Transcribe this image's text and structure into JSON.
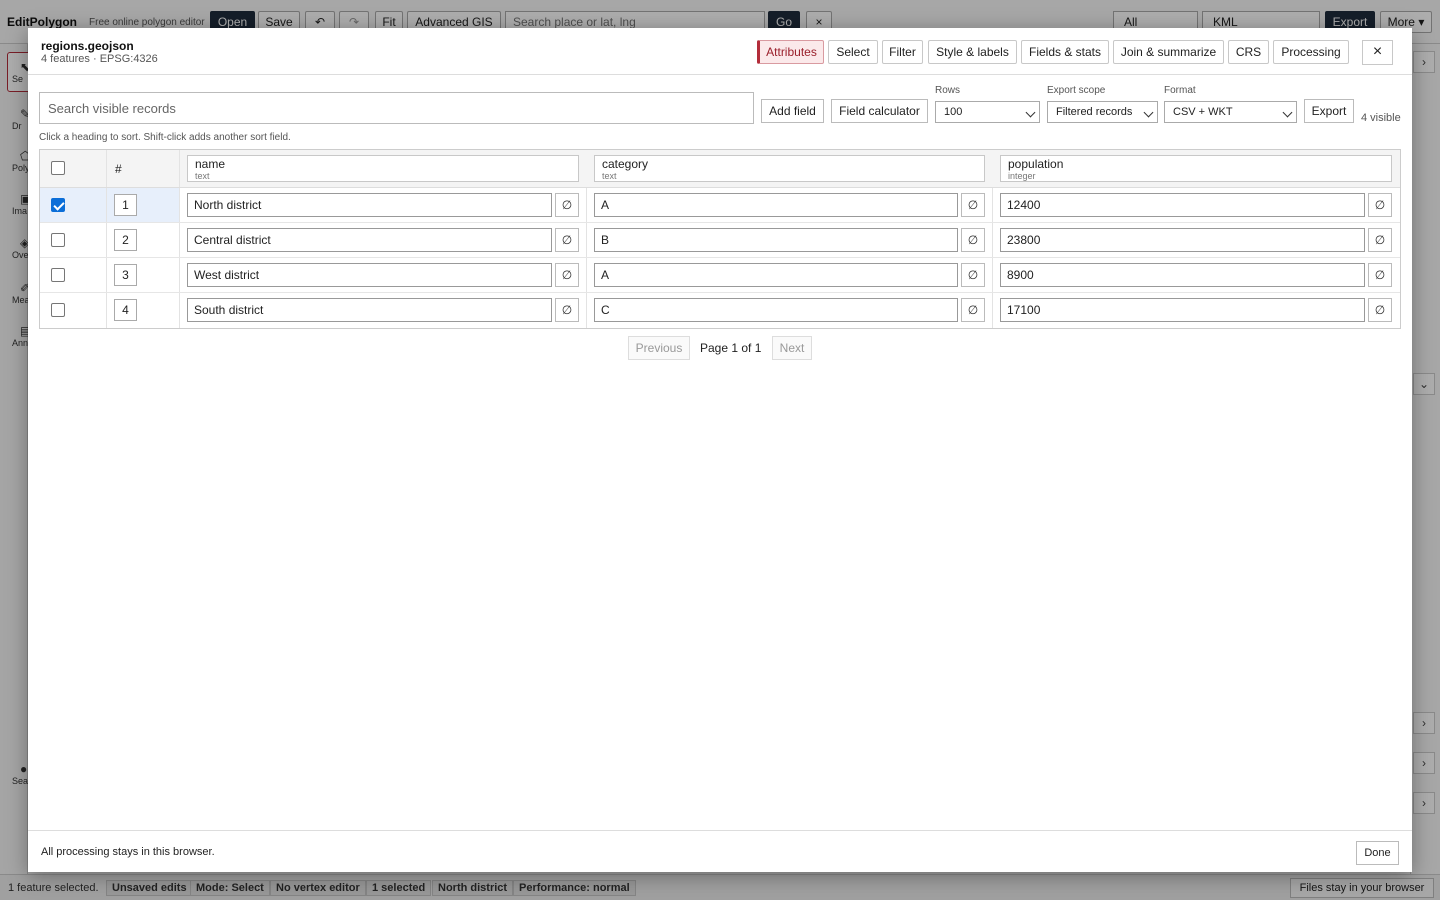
{
  "app": {
    "brand": "EditPolygon",
    "tagline": "Free online polygon editor",
    "toolbar": {
      "open": "Open",
      "save": "Save",
      "undo": "↶",
      "redo": "↷",
      "fit": "Fit",
      "advanced": "Advanced GIS",
      "search_placeholder": "Search place or lat, lng",
      "go": "Go",
      "clear": "×",
      "filter_value": "All",
      "format_value": "KML",
      "export": "Export",
      "more": "More ▾"
    },
    "rail": [
      {
        "icon": "⬉",
        "label": "Se"
      },
      {
        "icon": "✎",
        "label": "Dr"
      },
      {
        "icon": "⬠",
        "label": "Poly"
      },
      {
        "icon": "▣",
        "label": "Ima"
      },
      {
        "icon": "◈",
        "label": "Over"
      },
      {
        "icon": "✐",
        "label": "Mea"
      },
      {
        "icon": "▤",
        "label": "Ann"
      },
      {
        "icon": "●",
        "label": "Sea"
      }
    ],
    "statusbar": {
      "text": "1 feature selected.",
      "chips": [
        "Unsaved edits",
        "Mode: Select",
        "No vertex editor",
        "1 selected",
        "North district",
        "Performance: normal"
      ],
      "right": "Files stay in your browser"
    }
  },
  "modal": {
    "title": "regions.geojson",
    "subtitle": "4 features · EPSG:4326",
    "tabs": [
      "Attributes",
      "Select",
      "Filter",
      "Style & labels",
      "Fields & stats",
      "Join & summarize",
      "CRS",
      "Processing"
    ],
    "active_tab": "Attributes",
    "close": "×",
    "search_placeholder": "Search visible records",
    "add_field": "Add field",
    "field_calculator": "Field calculator",
    "rows_label": "Rows",
    "rows_value": "100",
    "export_scope_label": "Export scope",
    "export_scope_value": "Filtered records",
    "format_label": "Format",
    "format_value": "CSV + WKT",
    "export": "Export",
    "visible_count": "4 visible",
    "hint": "Click a heading to sort. Shift-click adds another sort field.",
    "table": {
      "hash": "#",
      "columns": [
        {
          "name": "name",
          "type": "text"
        },
        {
          "name": "category",
          "type": "text"
        },
        {
          "name": "population",
          "type": "integer"
        }
      ],
      "null_symbol": "∅",
      "rows": [
        {
          "num": "1",
          "checked": true,
          "values": [
            "North district",
            "A",
            "12400"
          ]
        },
        {
          "num": "2",
          "checked": false,
          "values": [
            "Central district",
            "B",
            "23800"
          ]
        },
        {
          "num": "3",
          "checked": false,
          "values": [
            "West district",
            "A",
            "8900"
          ]
        },
        {
          "num": "4",
          "checked": false,
          "values": [
            "South district",
            "C",
            "17100"
          ]
        }
      ]
    },
    "pager": {
      "previous": "Previous",
      "page": "Page 1 of 1",
      "next": "Next"
    },
    "footer": {
      "text": "All processing stays in this browser.",
      "done": "Done"
    }
  }
}
